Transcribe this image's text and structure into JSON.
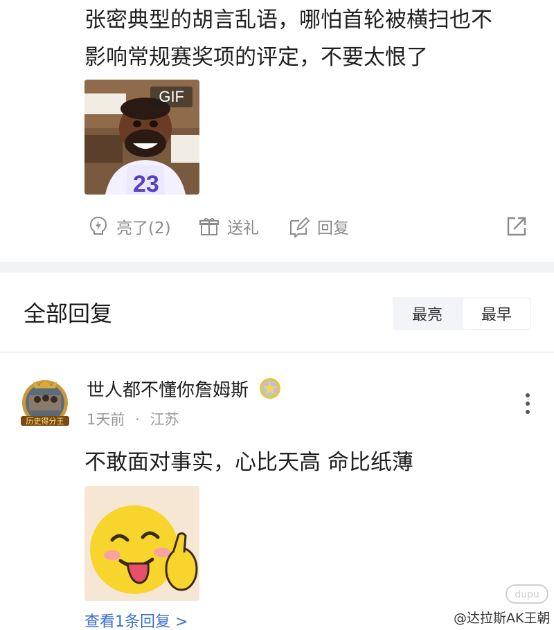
{
  "post": {
    "text_line1": "张密典型的胡言乱语，哪怕首轮被横扫也不",
    "text_line2": "影响常规赛奖项的评定，不要太恨了",
    "gif_badge": "GIF"
  },
  "actions": {
    "like_label": "亮了(2)",
    "gift_label": "送礼",
    "reply_label": "回复"
  },
  "section": {
    "title": "全部回复",
    "sort_options": [
      "最亮",
      "最早"
    ],
    "active_sort": "最早"
  },
  "reply": {
    "username": "世人都不懂你詹姆斯",
    "time": "1天前",
    "separator": "·",
    "location": "江苏",
    "avatar_caption": "历史得分王",
    "text": "不敢面对事实，心比天高 命比纸薄",
    "view_more": "查看1条回复 >"
  },
  "watermark": {
    "logo_text": "dupu",
    "text": "@达拉斯AK王朝"
  },
  "colors": {
    "link": "#3b6fd1",
    "muted": "#8a8a8a",
    "band": "#f2f3f5"
  },
  "icons": [
    "lightning-like-icon",
    "gift-icon",
    "edit-reply-icon",
    "share-icon",
    "more-vertical-icon",
    "medal-icon"
  ]
}
